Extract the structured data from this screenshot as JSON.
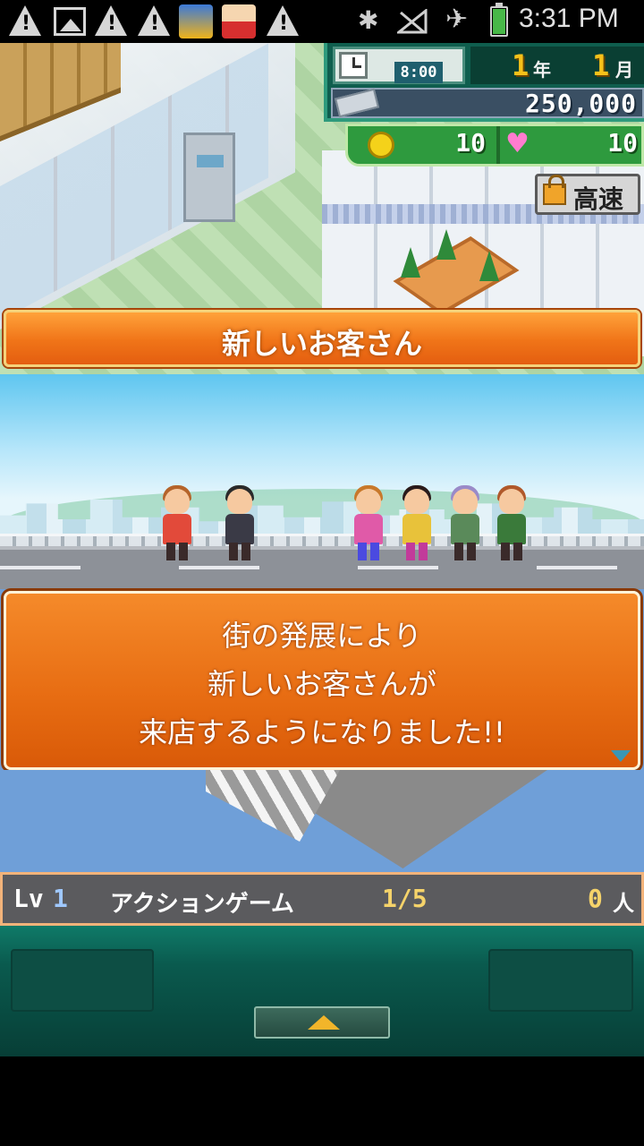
{
  "status_bar": {
    "time": "3:31 PM",
    "notification_icons": [
      "warning-icon",
      "image-icon",
      "warning-icon",
      "warning-icon",
      "bingo-app-icon",
      "crayon-shin-chan-app-icon",
      "warning-icon"
    ],
    "system_icons": [
      "bluetooth-icon",
      "no-signal-icon",
      "airplane-mode-icon",
      "battery-charging-icon"
    ]
  },
  "hud": {
    "clock_time": "8:00",
    "year_value": "1",
    "year_unit": "年",
    "month_value": "1",
    "month_unit": "月",
    "money": "250,000",
    "coins": "10",
    "hearts": "10",
    "speed_button_label": "高速"
  },
  "banner": {
    "title": "新しいお客さん"
  },
  "dialog": {
    "lines": [
      "街の発展により",
      "新しいお客さんが",
      "来店するようになりました!!"
    ]
  },
  "level_bar": {
    "lv_label": "Lv",
    "lv_value": "1",
    "category_name": "アクションゲーム",
    "progress": "1/5",
    "visitors": "0",
    "visitor_unit": "人"
  },
  "colors": {
    "banner_orange": "#f07418",
    "hud_green": "#0f5e4e",
    "coin_gold": "#f4d21a",
    "heart_pink": "#ff7ccf",
    "accent_yellow": "#f5d36a"
  }
}
